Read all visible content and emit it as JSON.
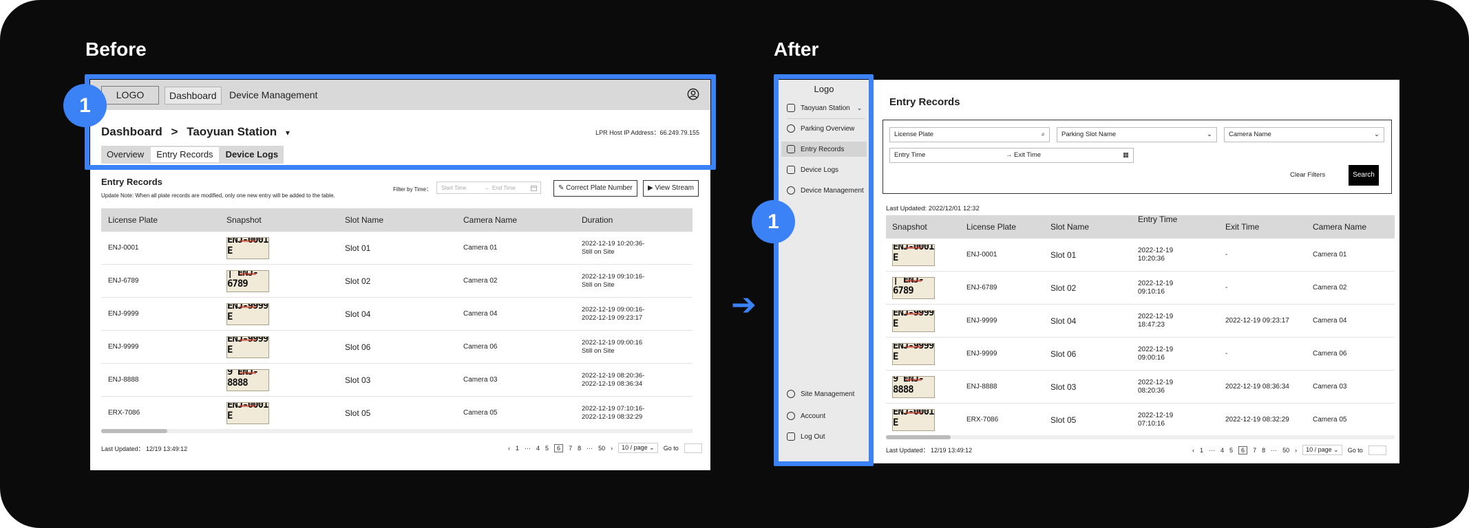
{
  "labels": {
    "before": "Before",
    "after": "After",
    "badge": "1"
  },
  "colors": {
    "highlight": "#3b82f6",
    "background": "#0b0b0b"
  },
  "before": {
    "logo": "LOGO",
    "nav": [
      "Dashboard",
      "Device Management"
    ],
    "breadcrumb": {
      "root": "Dashboard",
      "sep": ">",
      "station": "Taoyuan Station",
      "chev": "▾"
    },
    "ip": "LPR Host IP Address：66.249.79.155",
    "tabs": [
      "Overview",
      "Entry Records",
      "Device Logs"
    ],
    "heading": "Entry Records",
    "note": "Update Note: When all plate records are modified, only one new entry will be added to the table.",
    "filter": {
      "label": "Filter by Time：",
      "start": "Start Time",
      "arrow": "→",
      "end": "End Time"
    },
    "buttons": {
      "correct": "Correct Plate Number",
      "stream": "View Stream"
    },
    "columns": [
      "License Plate",
      "Snapshot",
      "Slot Name",
      "Camera Name",
      "Duration"
    ],
    "rows": [
      {
        "plate": "ENJ-0001",
        "snap": "ENJ-0001 E",
        "slot": "Slot 01",
        "camera": "Camera 01",
        "dur1": "2022-12-19 10:20:36-",
        "dur2": "Still on Site"
      },
      {
        "plate": "ENJ-6789",
        "snap": "| ENJ-6789",
        "slot": "Slot 02",
        "camera": "Camera 02",
        "dur1": "2022-12-19 09:10:16-",
        "dur2": "Still on Site"
      },
      {
        "plate": "ENJ-9999",
        "snap": "ENJ-9999 E",
        "slot": "Slot 04",
        "camera": "Camera 04",
        "dur1": "2022-12-19 09:00:16-",
        "dur2": "2022-12-19 09:23:17"
      },
      {
        "plate": "ENJ-9999",
        "snap": "ENJ-9999 E",
        "slot": "Slot 06",
        "camera": "Camera 06",
        "dur1": "2022-12-19 09:00:16",
        "dur2": "Still on Site"
      },
      {
        "plate": "ENJ-8888",
        "snap": "9 ENJ-8888",
        "slot": "Slot 03",
        "camera": "Camera 03",
        "dur1": "2022-12-19 08:20:36-",
        "dur2": "2022-12-19 08:36:34"
      },
      {
        "plate": "ERX-7086",
        "snap": "ENJ-0001 E",
        "slot": "Slot 05",
        "camera": "Camera 05",
        "dur1": "2022-12-19 07:10:16-",
        "dur2": "2022-12-19 08:32:29"
      }
    ],
    "updated": "Last Updated：  12/19 13:49:12",
    "pager": {
      "prev": "‹",
      "p1": "1",
      "dots": "···",
      "p4": "4",
      "p5": "5",
      "p6": "6",
      "p7": "7",
      "p8": "8",
      "p50": "50",
      "next": "›",
      "size": "10 / page ⌄",
      "goto": "Go to"
    }
  },
  "after": {
    "logo": "Logo",
    "station": "Taoyuan Station",
    "chev": "⌄",
    "nav": [
      "Parking Overview",
      "Entry Records",
      "Device Logs",
      "Device Management"
    ],
    "bottom_nav": [
      "Site Management",
      "Account",
      "Log Out"
    ],
    "title": "Entry Records",
    "filters": {
      "plate": "License Plate",
      "slot": "Parking Slot Name",
      "camera": "Camera Name",
      "entry": "Entry Time",
      "arrow": "→",
      "exit": "Exit Time"
    },
    "clear": "Clear Filters",
    "search": "Search",
    "last_updated": "Last Updated: 2022/12/01 12:32",
    "columns": [
      "Snapshot",
      "License Plate",
      "Slot Name",
      "Entry Time",
      "Exit Time",
      "Camera Name"
    ],
    "rows": [
      {
        "snap": "ENJ-0001 E",
        "plate": "ENJ-0001",
        "slot": "Slot 01",
        "entry1": "2022-12-19",
        "entry2": "10:20:36",
        "exit": "-",
        "camera": "Camera 01"
      },
      {
        "snap": "| ENJ-6789",
        "plate": "ENJ-6789",
        "slot": "Slot 02",
        "entry1": "2022-12-19",
        "entry2": "09:10:16",
        "exit": "-",
        "camera": "Camera 02"
      },
      {
        "snap": "ENJ-9999 E",
        "plate": "ENJ-9999",
        "slot": "Slot 04",
        "entry1": "2022-12-19",
        "entry2": "18:47:23",
        "exit": "2022-12-19 09:23:17",
        "camera": "Camera 04"
      },
      {
        "snap": "ENJ-9999 E",
        "plate": "ENJ-9999",
        "slot": "Slot 06",
        "entry1": "2022-12-19",
        "entry2": "09:00:16",
        "exit": "-",
        "camera": "Camera 06"
      },
      {
        "snap": "9 ENJ-8888",
        "plate": "ENJ-8888",
        "slot": "Slot 03",
        "entry1": "2022-12-19",
        "entry2": "08:20:36",
        "exit": "2022-12-19 08:36:34",
        "camera": "Camera 03"
      },
      {
        "snap": "ENJ-0001 E",
        "plate": "ERX-7086",
        "slot": "Slot 05",
        "entry1": "2022-12-19",
        "entry2": "07:10:16",
        "exit": "2022-12-19 08:32:29",
        "camera": "Camera 05"
      }
    ],
    "updated": "Last Updated：  12/19 13:49:12"
  }
}
